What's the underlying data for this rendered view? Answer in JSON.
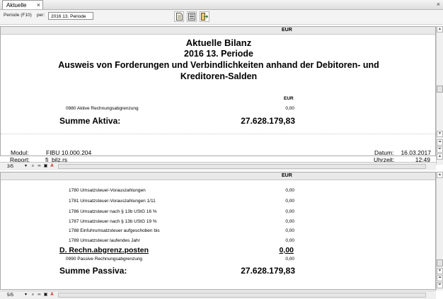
{
  "tab": {
    "title": "Aktuelle Bilanz"
  },
  "toolbar": {
    "period_label": "Periode (F10)",
    "per_label": "per:",
    "per_value": "2016 13. Periode"
  },
  "report": {
    "col_header": "EUR",
    "title": "Aktuelle Bilanz",
    "subtitle": "2016 13. Periode",
    "heading_line1": "Ausweis von Forderungen und Verbindlichkeiten anhand der Debitoren- und",
    "heading_line2": "Kreditoren-Salden",
    "small_eur": "EUR",
    "aktiva_row": {
      "label": "0980 Aktive Rechnungsabgrenzung",
      "value": "0,00"
    },
    "summe_aktiva": {
      "label": "Summe Aktiva:",
      "value": "27.628.179,83"
    },
    "footer": {
      "modul_label": "Modul:",
      "modul_value": "FIBU 10.000.204",
      "report_label": "Report:",
      "report_value": "fi_bilz.rs",
      "datum_label": "Datum:",
      "datum_value": "16.03.2017",
      "uhrzeit_label": "Uhrzeit:",
      "uhrzeit_value": "12:49"
    }
  },
  "pane1_nav": {
    "page": "3/5"
  },
  "pane2": {
    "col_header": "EUR",
    "rows": [
      {
        "label": "1780 Umsatzsteuer-Vorauszahlungen",
        "value": "0,00"
      },
      {
        "label": "1781 Umsatzsteuer-Vorauszahlungen 1/11",
        "value": "0,00"
      },
      {
        "label": "1786 Umsatzsteuer nach § 13b UStG 16 %",
        "value": "0,00"
      },
      {
        "label": "1787 Umsatzsteuer nach § 13b UStG 19 %",
        "value": "0,00"
      },
      {
        "label": "1788 Einfuhrumsatzsteuer aufgeschoben bis",
        "value": "0,00"
      },
      {
        "label": "1789 Umsatzsteuer laufendes Jahr",
        "value": "0,00"
      }
    ],
    "section": {
      "label": "D. Rechn.abgrenz.posten",
      "value": "0,00"
    },
    "passiva_row": {
      "label": "0990 Passive Rechnungsabgrenzung",
      "value": "0,00"
    },
    "summe_passiva": {
      "label": "Summe Passiva:",
      "value": "27.628.179,83"
    }
  },
  "pane2_nav": {
    "page": "5/5"
  },
  "icons": [
    "document-icon",
    "list-icon",
    "exit-icon",
    "search-icon",
    "binoculars-icon",
    "print-icon",
    "printer-setup-icon",
    "pdf-icon",
    "chevron-up-icon",
    "chevron-down-icon",
    "double-chevron-up-icon",
    "double-chevron-down-icon"
  ]
}
